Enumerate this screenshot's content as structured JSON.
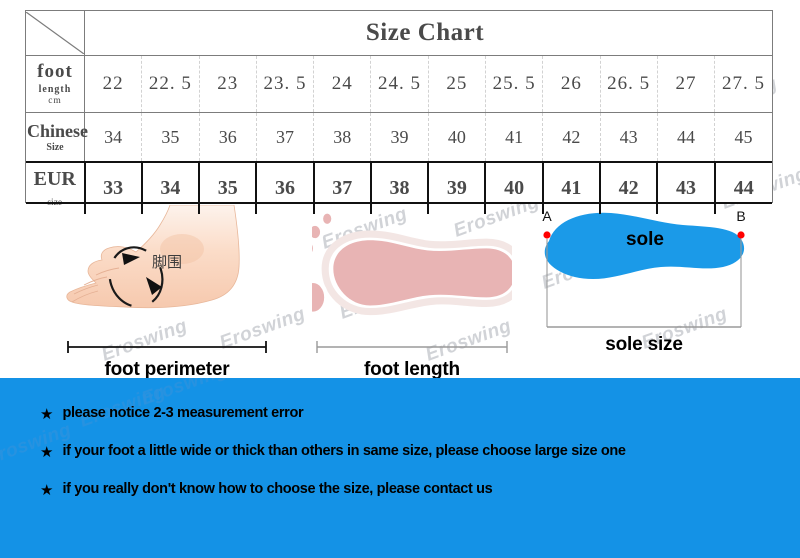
{
  "chart_data": {
    "type": "table",
    "title": "Size Chart",
    "row_labels": [
      {
        "main": "foot",
        "sub": "length",
        "unit": "cm"
      },
      {
        "main": "Chinese",
        "sub": "Size",
        "unit": ""
      },
      {
        "main": "EUR",
        "sub": "",
        "unit": "size"
      }
    ],
    "rows": [
      {
        "label": "foot length cm",
        "values": [
          "22",
          "22. 5",
          "23",
          "23. 5",
          "24",
          "24. 5",
          "25",
          "25. 5",
          "26",
          "26. 5",
          "27",
          "27. 5"
        ]
      },
      {
        "label": "Chinese Size",
        "values": [
          "34",
          "35",
          "36",
          "37",
          "38",
          "39",
          "40",
          "41",
          "42",
          "43",
          "44",
          "45"
        ]
      },
      {
        "label": "EUR size",
        "values": [
          "33",
          "34",
          "35",
          "36",
          "37",
          "38",
          "39",
          "40",
          "41",
          "42",
          "43",
          "44"
        ]
      }
    ],
    "colors": {
      "title": "#e2721f",
      "label": "#e2721f",
      "value": "#4a4a4a",
      "eur_value": "#000000",
      "border": "#7c7c7c",
      "notice_background": "#1492e6",
      "sole": "#1b9ae8",
      "footprint": "#e8b4b4",
      "marker": "#ff0000"
    }
  },
  "diagrams": [
    {
      "name": "foot-perimeter",
      "caption": "foot perimeter",
      "annotation": "脚围"
    },
    {
      "name": "foot-length",
      "caption": "foot length",
      "annotation": ""
    },
    {
      "name": "sole-size",
      "caption": "sole size",
      "label": "sole",
      "point_a": "A",
      "point_b": "B"
    }
  ],
  "notices": {
    "bullet": "★",
    "items": [
      "please notice 2-3 measurement error",
      "if your foot a little wide or thick than others in same size, please choose large size one",
      "if you really don't know how to choose the size, please contact us"
    ]
  },
  "watermark": {
    "text": "Eroswing"
  }
}
